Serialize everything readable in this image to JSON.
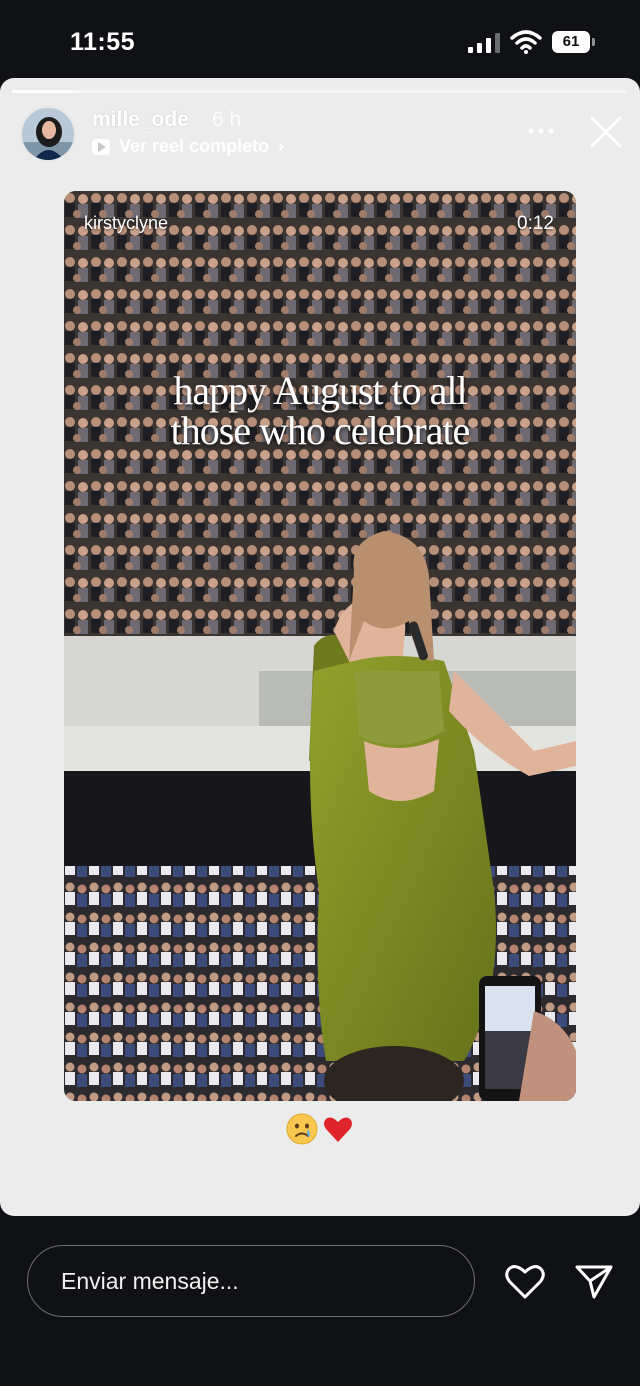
{
  "status_bar": {
    "time": "11:55",
    "battery_level": "61",
    "icons": [
      "cellular-signal-icon",
      "wifi-icon",
      "battery-icon"
    ]
  },
  "story": {
    "progress": 0.1,
    "username": "mille_ode",
    "time_ago": "6 h",
    "reel_link_label": "Ver reel completo",
    "icons": [
      "avatar",
      "reel-play-icon",
      "chevron-right-icon",
      "more-options-icon",
      "close-icon"
    ]
  },
  "reel": {
    "credit": "kirstyclyne",
    "duration": "0:12",
    "caption_line1": "happy August to all",
    "caption_line2": "those who celebrate"
  },
  "reaction": {
    "emojis": [
      "crying-face-emoji",
      "red-heart-emoji"
    ]
  },
  "footer": {
    "message_placeholder": "Enviar mensaje...",
    "icons": [
      "heart-icon",
      "send-icon"
    ]
  },
  "colors": {
    "app_background": "#101114",
    "story_background": "#ececec",
    "dress": "#7d8a23"
  }
}
